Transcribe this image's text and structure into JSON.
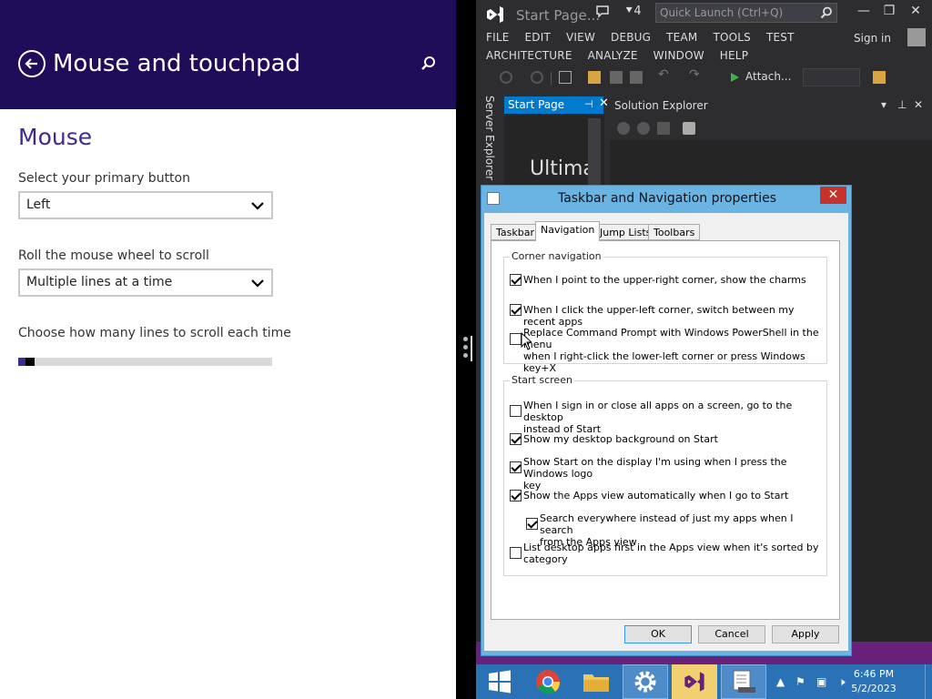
{
  "settings": {
    "title": "Mouse and touchpad",
    "section": "Mouse",
    "primary_button_label": "Select your primary button",
    "primary_button_value": "Left",
    "scroll_label": "Roll the mouse wheel to scroll",
    "scroll_value": "Multiple lines at a time",
    "lines_label": "Choose how many lines to scroll each time",
    "lines_slider_fraction": 0.03
  },
  "vs": {
    "title": "Start Page...",
    "notifications": "4",
    "quick_launch_placeholder": "Quick Launch (Ctrl+Q)",
    "menu_row1": [
      "FILE",
      "EDIT",
      "VIEW",
      "DEBUG",
      "TEAM",
      "TOOLS",
      "TEST"
    ],
    "menu_row2": [
      "ARCHITECTURE",
      "ANALYZE",
      "WINDOW",
      "HELP"
    ],
    "sign_in": "Sign in",
    "attach_label": "Attach...",
    "server_explorer": "Server Explorer",
    "start_tab": "Start Page",
    "start_heading": "Ultima",
    "solution_explorer": "Solution Explorer",
    "accent_color": "#007acc",
    "status_color": "#68217a"
  },
  "dialog": {
    "title": "Taskbar and Navigation properties",
    "close": "✕",
    "tabs": [
      "Taskbar",
      "Navigation",
      "Jump Lists",
      "Toolbars"
    ],
    "active_tab": "Navigation",
    "corner_group": "Corner navigation",
    "corner_items": [
      {
        "line1": "When I point to the upper-right corner, show the charms",
        "line2": "",
        "checked": true
      },
      {
        "line1": "When I click the upper-left corner, switch between my recent apps",
        "line2": "",
        "checked": true
      },
      {
        "line1": "Replace Command Prompt with Windows PowerShell in the menu",
        "line2": "when I right-click the lower-left corner or press Windows key+X",
        "checked": false
      }
    ],
    "start_group": "Start screen",
    "start_items": [
      {
        "line1": "When I sign in or close all apps on a screen, go to the desktop",
        "line2": "instead of Start",
        "checked": false
      },
      {
        "line1": "Show my desktop background on Start",
        "line2": "",
        "checked": true
      },
      {
        "line1": "Show Start on the display I'm using when I press the Windows logo",
        "line2": "key",
        "checked": true
      },
      {
        "line1": "Show the Apps view automatically when I go to Start",
        "line2": "",
        "checked": true
      },
      {
        "line1": "Search everywhere instead of just my apps when I search",
        "line2": "from the Apps view",
        "checked": true
      },
      {
        "line1": "List desktop apps first in the Apps view when it's sorted by",
        "line2": "category",
        "checked": false
      }
    ],
    "ok": "OK",
    "cancel": "Cancel",
    "apply": "Apply"
  },
  "taskbar": {
    "items": [
      "start-icon",
      "chrome-icon",
      "file-explorer-icon",
      "settings-icon",
      "visual-studio-icon",
      "taskbar-properties-icon"
    ],
    "time": "6:46 PM",
    "date": "5/2/2023"
  }
}
